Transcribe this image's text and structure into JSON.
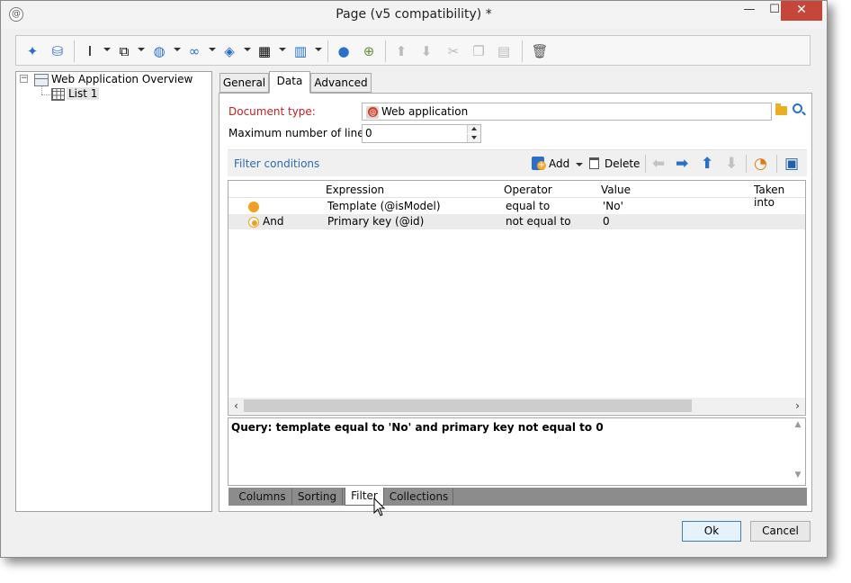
{
  "window": {
    "title": "Page (v5 compatibility) *",
    "minimize": "—",
    "maximize": "☐",
    "close": "✕"
  },
  "toolbar": {
    "icons": [
      "wand-icon",
      "database-icon",
      "text-cursor-icon",
      "insert-icon",
      "globe-icon",
      "link-icon",
      "cube-icon",
      "table-icon",
      "columns-icon",
      "person-icon",
      "add-user-icon",
      "move-up-icon",
      "move-down-icon",
      "cut-icon",
      "copy-icon",
      "paste-icon",
      "delete-icon"
    ]
  },
  "tree": {
    "root": "Web Application Overview",
    "child": "List 1",
    "expander": "−"
  },
  "tabs": [
    {
      "label": "General"
    },
    {
      "label": "Data"
    },
    {
      "label": "Advanced"
    }
  ],
  "active_tab": "Data",
  "form": {
    "doctype_label": "Document type:",
    "doctype_value": "Web application",
    "maxlines_label": "Maximum number of lines:",
    "maxlines_value": "0"
  },
  "filter": {
    "title": "Filter conditions",
    "add_label": "Add",
    "delete_label": "Delete",
    "columns": [
      "Expression",
      "Operator",
      "Value",
      "Taken into"
    ],
    "rows": [
      {
        "logic": "",
        "expression": "Template (@isModel)",
        "operator": "equal to",
        "value": "'No'"
      },
      {
        "logic": "And",
        "expression": "Primary key (@id)",
        "operator": "not equal to",
        "value": "0"
      }
    ],
    "query": "Query: template equal to 'No' and primary key not equal to 0"
  },
  "bottom_tabs": [
    {
      "label": "Columns"
    },
    {
      "label": "Sorting"
    },
    {
      "label": "Filter"
    },
    {
      "label": "Collections"
    }
  ],
  "active_bottom_tab": "Filter",
  "buttons": {
    "ok": "Ok",
    "cancel": "Cancel"
  },
  "colors": {
    "accent": "#2a6fc9",
    "required_label": "#c02020",
    "close_button": "#c7463a"
  }
}
